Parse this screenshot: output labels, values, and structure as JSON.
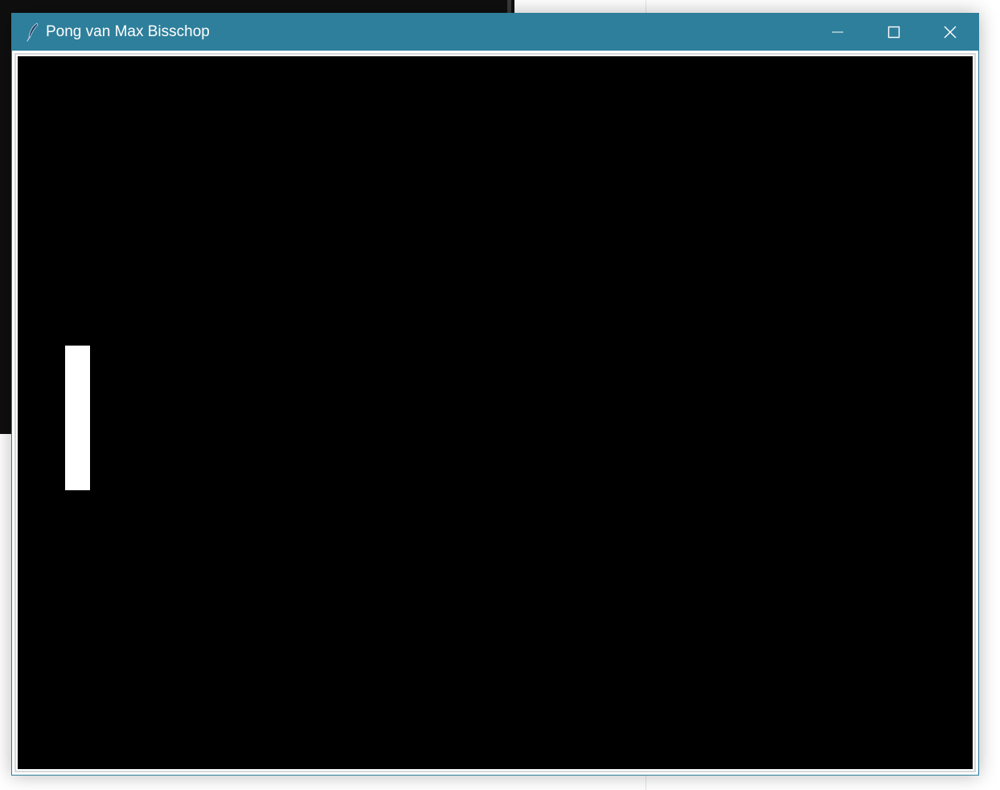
{
  "window": {
    "title": "Pong van Max Bisschop",
    "title_bar_color": "#2e7f9b",
    "icons": {
      "app": "feather-icon",
      "minimize": "minimize-icon",
      "maximize": "maximize-icon",
      "close": "close-icon"
    }
  },
  "game": {
    "background_color": "#000000",
    "paddle_color": "#ffffff"
  }
}
